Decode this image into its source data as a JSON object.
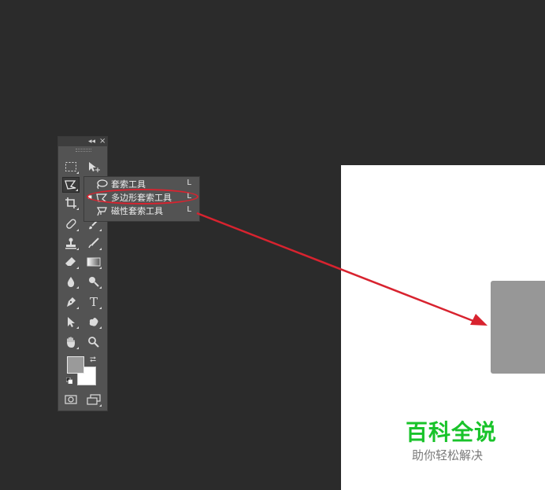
{
  "toolbar": {
    "collapse_icon": "collapse-icon",
    "close_icon": "close-icon",
    "type_tool_label": "T"
  },
  "flyout": {
    "items": [
      {
        "label": "套索工具",
        "shortcut": "L",
        "selected": false
      },
      {
        "label": "多边形套索工具",
        "shortcut": "L",
        "selected": true
      },
      {
        "label": "磁性套索工具",
        "shortcut": "L",
        "selected": false
      }
    ],
    "selected_marker": "▪"
  },
  "colors": {
    "foreground": "#9a9a9a",
    "background": "#ffffff",
    "annotation_red": "#d8232f",
    "watermark_green": "#19c32a",
    "shape_gray": "#979797"
  },
  "watermark": {
    "title": "百科全说",
    "subtitle": "助你轻松解决"
  }
}
